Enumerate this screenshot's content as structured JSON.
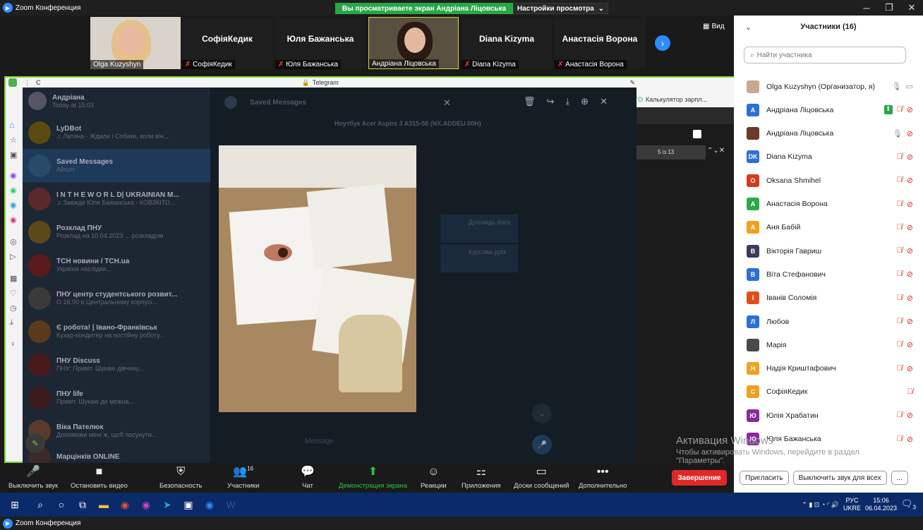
{
  "app_title": "Zoom Конференция",
  "share_banner": "Вы просматриваете экран Андріана Ліцовська",
  "view_settings": "Настройки просмотра",
  "view_button": "Вид",
  "video_tiles": [
    {
      "name": "Olga Kuzyshyn",
      "big": "",
      "muted": false
    },
    {
      "name": "СофіяКедик",
      "big": "СофіяКедик",
      "muted": true
    },
    {
      "name": "Юля Бажанська",
      "big": "Юля Бажанська",
      "muted": true
    },
    {
      "name": "Андріана Ліцовська",
      "big": "",
      "muted": false
    },
    {
      "name": "Diana Kizyma",
      "big": "Diana Kizyma",
      "muted": true
    },
    {
      "name": "Анастасія Ворона",
      "big": "Анастасія Ворона",
      "muted": true
    }
  ],
  "shared": {
    "tab_title": "Telegram",
    "sender": "Андріана",
    "sender_time": "Today at 15:03",
    "header": "Saved Messages",
    "media_caption": "Ноутбук Acer Aspire 3 A315-58 (NX.ADDEU.00H)",
    "doc1": "Доповідь.docx",
    "doc2": "Курсова.pptx",
    "pager": "5 із 13",
    "calc_tab": "Калькулятор зарпл...",
    "compose": "Message",
    "chats": [
      {
        "title": "LyDBot",
        "snippet": "♫ Латина - Ждали і Собаки, коли він..."
      },
      {
        "title": "Saved Messages",
        "snippet": "Album"
      },
      {
        "title": "I N T H E W O R L D| UKRAINIAN M...",
        "snippet": "♫ Завжди Юля Бажанська - КОВЗКІТО..."
      },
      {
        "title": "Розклад ПНУ",
        "snippet": "Розклад на 10.04.2023 ... розкладом"
      },
      {
        "title": "ТСН новини / TCH.ua",
        "snippet": "Україна наслідки..."
      },
      {
        "title": "ПНУ центр студентського розвит...",
        "snippet": "О 16:00 в Центральному корпусі..."
      },
      {
        "title": "Є робота! | Івано-Франківськ",
        "snippet": "Кухар-кондитер на постійну роботу..."
      },
      {
        "title": "ПНУ Discuss",
        "snippet": "ПНУ: Привіт. Шукаю дівчину..."
      },
      {
        "title": "ПНУ life",
        "snippet": "Привіт. Шукаю де можна..."
      },
      {
        "title": "Віка Пателюк",
        "snippet": "Допоможи мені ж, щоб посунути..."
      },
      {
        "title": "Марцінків ONLINE",
        "snippet": ""
      }
    ]
  },
  "toolbar": {
    "mute": "Выключить звук",
    "video": "Остановить видео",
    "security": "Безопасность",
    "participants": "Участники",
    "participants_count": "16",
    "chat": "Чат",
    "share": "Демонстрация экрана",
    "reactions": "Реакции",
    "apps": "Приложения",
    "whiteboards": "Доски сообщений",
    "more": "Дополнительно",
    "end": "Завершение"
  },
  "panel": {
    "title": "Участники (16)",
    "search_placeholder": "Найти участника",
    "invite": "Пригласить",
    "mute_all": "Выключить звук для всех",
    "more": "...",
    "participants": [
      {
        "initials": "",
        "name": "Olga Kuzyshyn (Организатор, я)",
        "color": "#c8a890",
        "mic": "on",
        "cam": "on"
      },
      {
        "initials": "А",
        "name": "Андріана Ліцовська",
        "color": "#2d6fd6",
        "mic": "muted",
        "cam": "off",
        "sharing": true
      },
      {
        "initials": "",
        "name": "Андріана Ліцовська",
        "color": "#6a3a2a",
        "mic": "on",
        "cam": "off"
      },
      {
        "initials": "DK",
        "name": "Diana Kizyma",
        "color": "#2d6fd6",
        "mic": "muted",
        "cam": "off"
      },
      {
        "initials": "O",
        "name": "Oksana Shmihel",
        "color": "#d63a1a",
        "mic": "muted",
        "cam": "off"
      },
      {
        "initials": "А",
        "name": "Анастасія Ворона",
        "color": "#2aaa4a",
        "mic": "muted",
        "cam": "off"
      },
      {
        "initials": "А",
        "name": "Аня Бабій",
        "color": "#f0a020",
        "mic": "muted",
        "cam": "off"
      },
      {
        "initials": "В",
        "name": "Вікторія Гавриш",
        "color": "#3a3a5a",
        "mic": "muted",
        "cam": "off"
      },
      {
        "initials": "В",
        "name": "Віта Стефанович",
        "color": "#2d6fd6",
        "mic": "muted",
        "cam": "off"
      },
      {
        "initials": "І",
        "name": "Іванів Соломія",
        "color": "#e0501a",
        "mic": "muted",
        "cam": "off"
      },
      {
        "initials": "Л",
        "name": "Любов",
        "color": "#2d6fd6",
        "mic": "muted",
        "cam": "off"
      },
      {
        "initials": "",
        "name": "Марія",
        "color": "#4a4a4a",
        "mic": "muted",
        "cam": "off"
      },
      {
        "initials": "Н",
        "name": "Надія Криштафович",
        "color": "#f0a020",
        "mic": "muted",
        "cam": "off"
      },
      {
        "initials": "С",
        "name": "СофіяКедик",
        "color": "#f0a020",
        "mic": "muted",
        "cam": ""
      },
      {
        "initials": "Ю",
        "name": "Юлія Храбатин",
        "color": "#8a2aa0",
        "mic": "muted",
        "cam": "off"
      },
      {
        "initials": "Ю",
        "name": "Юля Бажанська",
        "color": "#8a2aa0",
        "mic": "muted",
        "cam": "off"
      }
    ]
  },
  "activation": {
    "title": "Активация Windows",
    "text": "Чтобы активировать Windows, перейдите в раздел \"Параметры\"."
  },
  "taskbar": {
    "lang": "РУС",
    "layout": "UKRE",
    "time": "15:06",
    "date": "06.04.2023",
    "notif_count": "3"
  }
}
